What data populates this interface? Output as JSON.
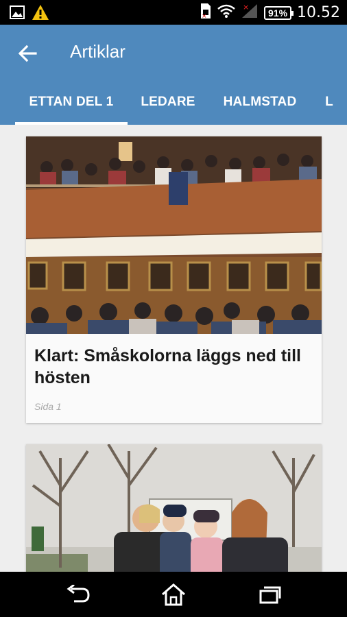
{
  "status_bar": {
    "battery": "91%",
    "time": "10.52"
  },
  "app_bar": {
    "title": "Artiklar"
  },
  "tabs": [
    {
      "label": "ETTAN DEL 1",
      "active": true
    },
    {
      "label": "LEDARE",
      "active": false
    },
    {
      "label": "HALMSTAD",
      "active": false
    },
    {
      "label": "L",
      "active": false
    }
  ],
  "articles": [
    {
      "title": "Klart: Småskolorna läggs ned till hösten",
      "page": "Sida 1"
    },
    {
      "title": "",
      "page": ""
    }
  ],
  "colors": {
    "accent": "#4f89bd",
    "background": "#eeeeee",
    "card": "#fafafa"
  },
  "icons": {
    "status_left": [
      "image-icon",
      "warning-icon"
    ],
    "status_right": [
      "sim-icon",
      "wifi-icon",
      "signal-icon",
      "battery-icon"
    ],
    "navbar": [
      "back-nav-icon",
      "home-icon",
      "recents-icon"
    ]
  }
}
